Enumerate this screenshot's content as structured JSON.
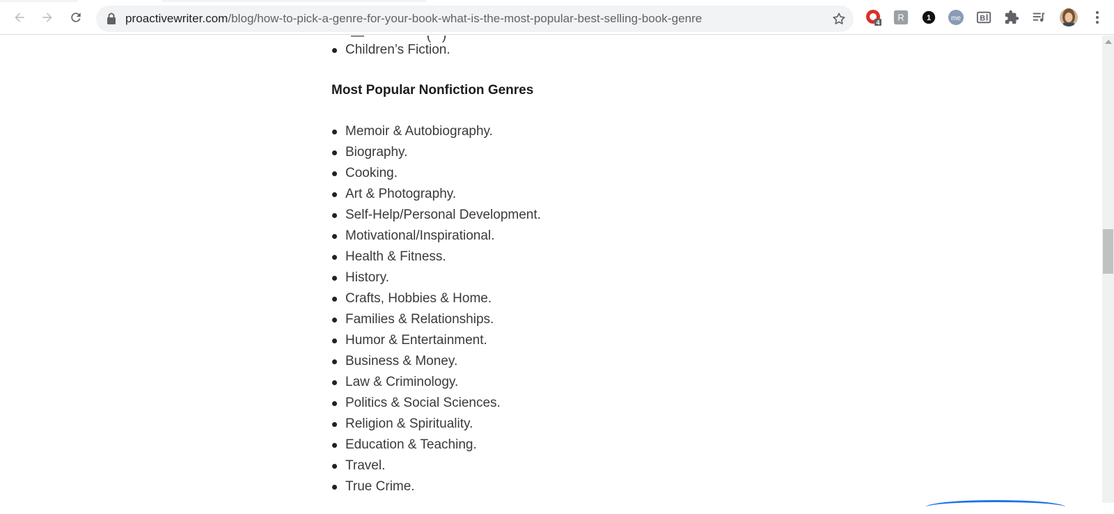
{
  "browser": {
    "url_domain": "proactivewriter.com",
    "url_path": "/blog/how-to-pick-a-genre-for-your-book-what-is-the-most-popular-best-selling-book-genre",
    "extensions": [
      {
        "name": "adblock-icon",
        "badge": "4"
      },
      {
        "name": "grammar-extension-icon",
        "label": "R"
      },
      {
        "name": "password-manager-icon",
        "label": "1"
      },
      {
        "name": "momentum-icon",
        "label": "me"
      },
      {
        "name": "bookmark-extension-icon",
        "label": "B"
      },
      {
        "name": "puzzle-extensions-icon"
      },
      {
        "name": "reading-list-icon"
      },
      {
        "name": "profile-avatar"
      }
    ]
  },
  "article": {
    "prev_item": "Children’s Fiction.",
    "heading": "Most Popular Nonfiction Genres",
    "genres": [
      "Memoir & Autobiography.",
      "Biography.",
      "Cooking.",
      "Art & Photography.",
      "Self-Help/Personal Development.",
      "Motivational/Inspirational.",
      "Health & Fitness.",
      "History.",
      "Crafts, Hobbies & Home.",
      "Families & Relationships.",
      "Humor & Entertainment.",
      "Business & Money.",
      "Law & Criminology.",
      "Politics & Social Sciences.",
      "Religion & Spirituality.",
      "Education & Teaching.",
      "Travel.",
      "True Crime."
    ]
  },
  "colors": {
    "omnibox_bg": "#f1f3f4",
    "icon_gray": "#5f6368",
    "adblock_red": "#d93025",
    "accent_blue": "#1a73e8"
  }
}
